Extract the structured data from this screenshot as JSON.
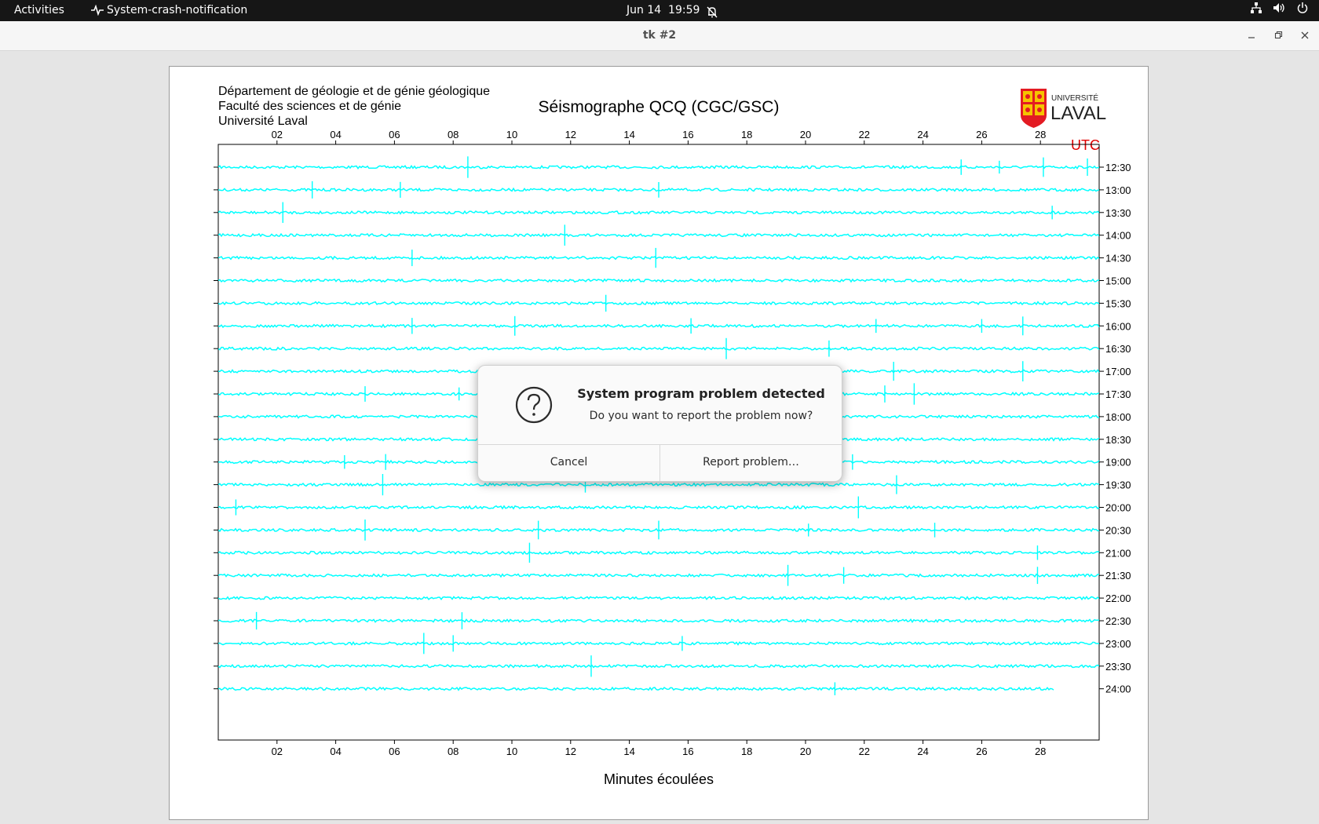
{
  "topbar": {
    "activities": "Activities",
    "app_menu": "System-crash-notification",
    "date": "Jun 14",
    "time": "19:59"
  },
  "window": {
    "title": "tk #2"
  },
  "seismograph": {
    "header_lines": [
      "Département de géologie et de génie géologique",
      "Faculté des sciences et de génie",
      "Université Laval"
    ],
    "title": "Séismographe QCQ (CGC/GSC)",
    "logo_text": [
      "UNIVERSITÉ",
      "LAVAL"
    ],
    "utc_label": "UTC",
    "xlabel": "Minutes écoulées",
    "trace_color": "#00ffff",
    "utc_color": "#e00000"
  },
  "chart_data": {
    "type": "line",
    "title": "Séismographe QCQ (CGC/GSC)",
    "xlabel": "Minutes écoulées",
    "x_ticks": [
      "02",
      "04",
      "06",
      "08",
      "10",
      "12",
      "14",
      "16",
      "18",
      "20",
      "22",
      "24",
      "26",
      "28"
    ],
    "xlim": [
      0,
      30
    ],
    "rows": [
      "12:30",
      "13:00",
      "13:30",
      "14:00",
      "14:30",
      "15:00",
      "15:30",
      "16:00",
      "16:30",
      "17:00",
      "17:30",
      "18:00",
      "18:30",
      "19:00",
      "19:30",
      "20:00",
      "20:30",
      "21:00",
      "21:30",
      "22:00",
      "22:30",
      "23:00",
      "23:30",
      "24:00"
    ],
    "spikes": [
      [
        8.5,
        25.3,
        26.6,
        28.1,
        29.6
      ],
      [
        3.2,
        6.2,
        15.0
      ],
      [
        2.2,
        28.4
      ],
      [
        11.8
      ],
      [
        6.6,
        14.9
      ],
      [],
      [
        13.2
      ],
      [
        6.6,
        10.1,
        16.1,
        22.4,
        26.0,
        27.4
      ],
      [
        17.3,
        20.8
      ],
      [
        23.0,
        27.4
      ],
      [
        5.0,
        8.2,
        22.7,
        23.7
      ],
      [],
      [],
      [
        4.3,
        5.7,
        21.6
      ],
      [
        5.6,
        12.5,
        23.1
      ],
      [
        0.6,
        21.8
      ],
      [
        5.0,
        10.9,
        15.0,
        20.1,
        24.4
      ],
      [
        10.6,
        27.9
      ],
      [
        19.4,
        21.3,
        27.9
      ],
      [],
      [
        1.3,
        8.3
      ],
      [
        7.0,
        8.0,
        15.8
      ],
      [
        12.7
      ],
      [
        21.0
      ]
    ],
    "last_row_end": 28.5
  },
  "dialog": {
    "title": "System program problem detected",
    "message": "Do you want to report the problem now?",
    "cancel": "Cancel",
    "report": "Report problem…"
  }
}
